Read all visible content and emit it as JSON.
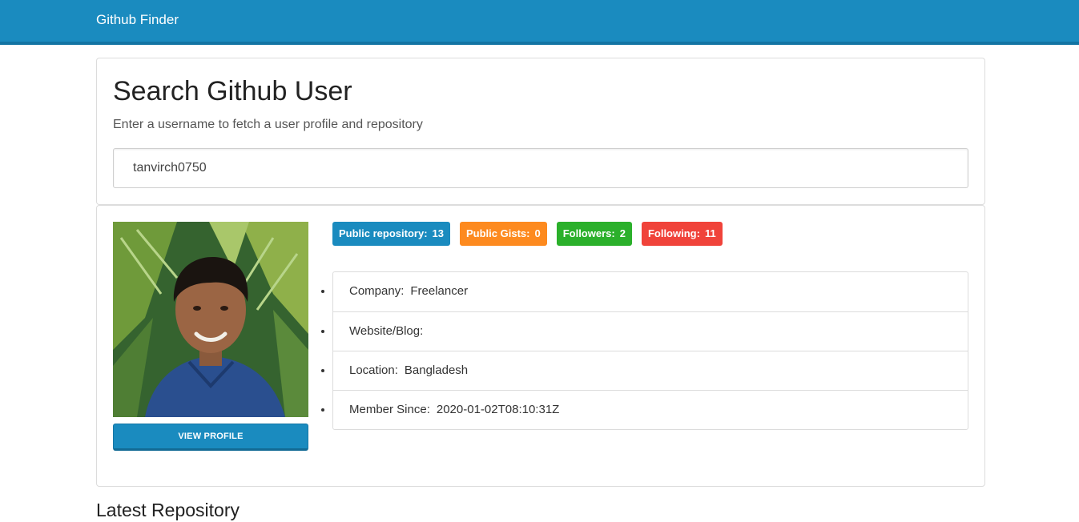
{
  "navbar": {
    "brand": "Github Finder"
  },
  "search": {
    "title": "Search Github User",
    "subtitle": "Enter a username to fetch a user profile and repository",
    "value": "tanvirch0750"
  },
  "profile": {
    "view_button": "VIEW PROFILE",
    "badges": [
      {
        "label": "Public repository:",
        "value": "13",
        "color": "#1a8bbf"
      },
      {
        "label": "Public Gists:",
        "value": "0",
        "color": "#fd8a1f"
      },
      {
        "label": "Followers:",
        "value": "2",
        "color": "#2bb02b"
      },
      {
        "label": "Following:",
        "value": "11",
        "color": "#f0433a"
      }
    ],
    "details": [
      {
        "label": "Company:",
        "value": "Freelancer"
      },
      {
        "label": "Website/Blog:",
        "value": ""
      },
      {
        "label": "Location:",
        "value": "Bangladesh"
      },
      {
        "label": "Member Since:",
        "value": "2020-01-02T08:10:31Z"
      }
    ]
  },
  "latest": {
    "title": "Latest Repository"
  }
}
